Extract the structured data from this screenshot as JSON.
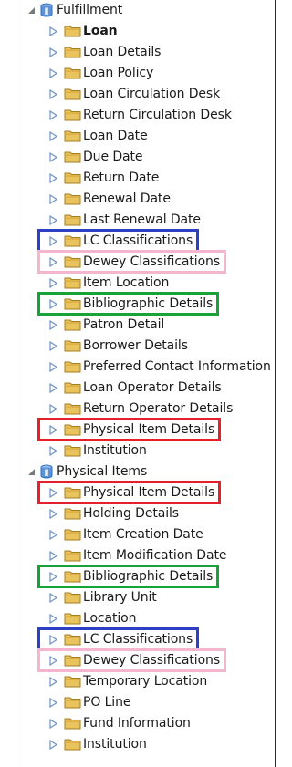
{
  "tree": [
    {
      "label": "Fulfillment",
      "icon": "database-cube-icon",
      "children": [
        {
          "label": "Loan",
          "selected": true
        },
        {
          "label": "Loan Details"
        },
        {
          "label": "Loan Policy"
        },
        {
          "label": "Loan Circulation Desk"
        },
        {
          "label": "Return Circulation Desk"
        },
        {
          "label": "Loan Date"
        },
        {
          "label": "Due Date"
        },
        {
          "label": "Return Date"
        },
        {
          "label": "Renewal Date"
        },
        {
          "label": "Last Renewal Date"
        },
        {
          "label": "LC Classifications",
          "highlight": "blue"
        },
        {
          "label": "Dewey Classifications",
          "highlight": "pink"
        },
        {
          "label": "Item Location"
        },
        {
          "label": "Bibliographic Details",
          "highlight": "green"
        },
        {
          "label": "Patron Detail"
        },
        {
          "label": "Borrower Details"
        },
        {
          "label": "Preferred Contact Information"
        },
        {
          "label": "Loan Operator Details"
        },
        {
          "label": "Return Operator Details"
        },
        {
          "label": "Physical Item Details",
          "highlight": "red"
        },
        {
          "label": "Institution"
        }
      ]
    },
    {
      "label": "Physical Items",
      "icon": "database-cube-icon",
      "children": [
        {
          "label": "Physical Item Details",
          "highlight": "red"
        },
        {
          "label": "Holding Details"
        },
        {
          "label": "Item Creation Date"
        },
        {
          "label": "Item Modification Date"
        },
        {
          "label": "Bibliographic Details",
          "highlight": "green"
        },
        {
          "label": "Library Unit"
        },
        {
          "label": "Location"
        },
        {
          "label": "LC Classifications",
          "highlight": "blue"
        },
        {
          "label": "Dewey Classifications",
          "highlight": "pink"
        },
        {
          "label": "Temporary Location"
        },
        {
          "label": "PO Line"
        },
        {
          "label": "Fund Information"
        },
        {
          "label": "Institution"
        }
      ]
    }
  ],
  "highlight_colors": {
    "blue": "#2f3fc4",
    "pink": "#f4b6cf",
    "green": "#17a338",
    "red": "#e3202c"
  },
  "colors": {
    "folder_fill": "#e9c35b",
    "folder_tab": "#d9a93a",
    "caret": "#6e93c7",
    "db_blue": "#2f6fc2"
  }
}
